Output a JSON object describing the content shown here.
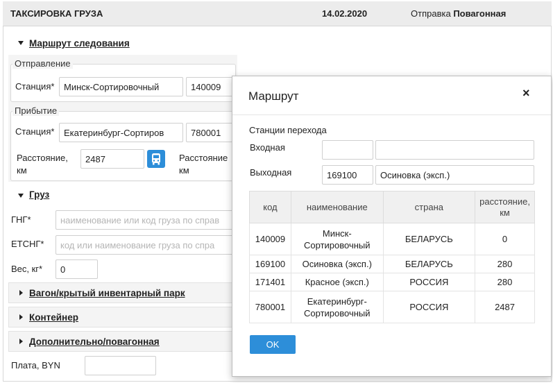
{
  "header": {
    "title": "ТАКСИРОВКА ГРУЗА",
    "date": "14.02.2020",
    "shipment_label": "Отправка",
    "shipment_value": "Повагонная"
  },
  "route": {
    "section_title": "Маршрут следования",
    "departure": {
      "legend": "Отправление",
      "station_label": "Станция*",
      "station_name": "Минск-Сортировочный",
      "station_code": "140009"
    },
    "arrival": {
      "legend": "Прибытие",
      "station_label": "Станция*",
      "station_name": "Екатеринбург-Сортиров",
      "station_code": "780001"
    },
    "distance_label_1": "Расстояние,",
    "distance_label_2": "км",
    "distance_value": "2487",
    "distance2_label_1": "Расстояние",
    "distance2_label_2": "км"
  },
  "cargo": {
    "section_title": "Груз",
    "gng_label": "ГНГ*",
    "gng_placeholder": "наименование или код груза по справ",
    "etsng_label": "ЕТСНГ*",
    "etsng_placeholder": "код или наименование груза по спра",
    "weight_label": "Вес, кг*",
    "weight_value": "0"
  },
  "collapsed_sections": [
    {
      "title": "Вагон/крытый инвентарный парк"
    },
    {
      "title": "Контейнер"
    },
    {
      "title": "Дополнительно/повагонная"
    }
  ],
  "payment": {
    "label": "Плата, BYN",
    "value": ""
  },
  "modal": {
    "title": "Маршрут",
    "close": "×",
    "transfer_title": "Станции перехода",
    "entry_label": "Входная",
    "entry_code": "",
    "entry_name": "",
    "exit_label": "Выходная",
    "exit_code": "169100",
    "exit_name": "Осиновка (эксп.)",
    "table": {
      "headers": [
        "код",
        "наименование",
        "страна",
        "расстояние, км"
      ],
      "rows": [
        {
          "code": "140009",
          "name": "Минск-Сортировочный",
          "country": "БЕЛАРУСЬ",
          "distance": "0"
        },
        {
          "code": "169100",
          "name": "Осиновка (эксп.)",
          "country": "БЕЛАРУСЬ",
          "distance": "280"
        },
        {
          "code": "171401",
          "name": "Красное (эксп.)",
          "country": "РОССИЯ",
          "distance": "280"
        },
        {
          "code": "780001",
          "name": "Екатеринбург-Сортировочный",
          "country": "РОССИЯ",
          "distance": "2487"
        }
      ]
    },
    "ok_label": "OK"
  },
  "colors": {
    "accent": "#2d8ed9",
    "header_bg": "#ececec",
    "panel_bg": "#f4f4f4"
  },
  "icons": {
    "route_button": "bus-icon",
    "close": "close-icon"
  }
}
